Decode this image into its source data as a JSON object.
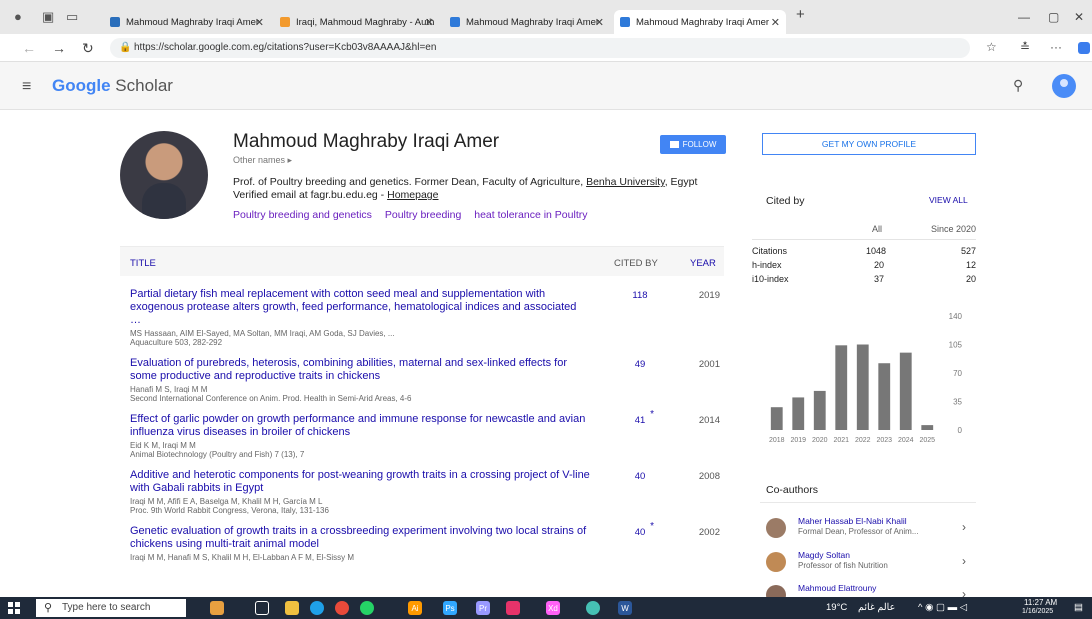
{
  "browser": {
    "tabs": [
      {
        "title": "Mahmoud Maghraby Iraqi Amer",
        "color": "#2a6ebb"
      },
      {
        "title": "Iraqi, Mahmoud Maghraby - Auth",
        "color": "#f29a2e"
      },
      {
        "title": "Mahmoud Maghraby Iraqi Amer",
        "color": "#2f7ad9"
      },
      {
        "title": "Mahmoud Maghraby Iraqi Amer",
        "color": "#2f7ad9"
      }
    ],
    "url": "https://scholar.google.com.eg/citations?user=Kcb03v8AAAAJ&hl=en"
  },
  "header": {
    "logo_google": "Google",
    "logo_scholar": "Scholar"
  },
  "profile": {
    "name": "Mahmoud Maghraby Iraqi Amer",
    "other_names": "Other names ▸",
    "bio_text": "Prof. of Poultry breeding and genetics. Former Dean, Faculty of Agriculture,",
    "bio_link": "Benha University",
    "bio_end": ", Egypt",
    "email_text": "Verified email at fagr.bu.edu.eg - ",
    "homepage": "Homepage",
    "tags": [
      "Poultry breeding and genetics",
      "Poultry breeding",
      "heat tolerance in Poultry"
    ],
    "follow_label": "FOLLOW"
  },
  "table": {
    "col_title": "TITLE",
    "col_cited": "CITED BY",
    "col_year": "YEAR",
    "rows": [
      {
        "title": "Partial dietary fish meal replacement with cotton seed meal and supplementation with exogenous protease alters growth, feed performance, hematological indices and associated …",
        "authors": "MS Hassaan, AIM El-Sayed, MA Soltan, MM Iraqi, AM Goda, SJ Davies, ...",
        "venue": "Aquaculture 503, 282-292",
        "cited": "118",
        "star": "",
        "year": "2019"
      },
      {
        "title": "Evaluation of purebreds, heterosis, combining abilities, maternal and sex-linked effects for some productive and reproductive traits in chickens",
        "authors": "Hanafi M S, Iraqi M M",
        "venue": "Second International Conference on Anim. Prod. Health in Semi-Arid Areas, 4-6",
        "cited": "49",
        "star": "",
        "year": "2001"
      },
      {
        "title": "Effect of garlic powder on growth performance and immune response for newcastle and avian influenza virus diseases in broiler of chickens",
        "authors": "Eid K M, Iraqi M M",
        "venue": "Animal Biotechnology (Poultry and Fish) 7 (13), 7",
        "cited": "41",
        "star": "*",
        "year": "2014"
      },
      {
        "title": "Additive and heterotic components for post-weaning growth traits in a crossing project of V-line with Gabali rabbits in Egypt",
        "authors": "Iraqi M M, Afifi E A, Baselga M, Khalil M H, García M L",
        "venue": "Proc. 9th World Rabbit Congress, Verona, Italy, 131-136",
        "cited": "40",
        "star": "",
        "year": "2008"
      },
      {
        "title": "Genetic evaluation of growth traits in a crossbreeding experiment involving two local strains of chickens using multi-trait animal model",
        "authors": "Iraqi M M, Hanafi M S, Khalil M H, El-Labban A F M, El-Sissy M",
        "venue": "",
        "cited": "40",
        "star": "*",
        "year": "2002"
      }
    ]
  },
  "sidebar": {
    "get_profile": "GET MY OWN PROFILE",
    "cited_by": "Cited by",
    "view_all": "VIEW ALL",
    "col_all": "All",
    "col_since": "Since 2020",
    "stats": [
      {
        "label": "Citations",
        "all": "1048",
        "since": "527"
      },
      {
        "label": "h-index",
        "all": "20",
        "since": "12"
      },
      {
        "label": "i10-index",
        "all": "37",
        "since": "20"
      }
    ],
    "coauthors_title": "Co-authors",
    "coauthors": [
      {
        "name": "Maher Hassab El-Nabi Khalil",
        "desc": "Formal Dean, Professor of Anim..."
      },
      {
        "name": "Magdy Soltan",
        "desc": "Professor of fish Nutrition"
      },
      {
        "name": "Mahmoud Elattrouny",
        "desc": ""
      }
    ]
  },
  "chart_data": {
    "type": "bar",
    "categories": [
      "2018",
      "2019",
      "2020",
      "2021",
      "2022",
      "2023",
      "2024",
      "2025"
    ],
    "values": [
      28,
      40,
      48,
      104,
      105,
      82,
      95,
      6
    ],
    "ylim": [
      0,
      140
    ],
    "yticks": [
      "140",
      "105",
      "70",
      "35",
      "0"
    ],
    "color": "#777777"
  },
  "taskbar": {
    "search_placeholder": "Type here to search",
    "weather": "19°C",
    "weather_text": "عالم غائم",
    "time": "11:27 AM",
    "date": "1/16/2025"
  }
}
